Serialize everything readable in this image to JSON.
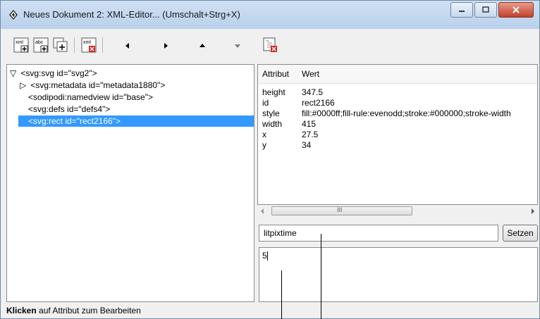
{
  "window": {
    "title": "Neues Dokument 2: XML-Editor... (Umschalt+Strg+X)"
  },
  "toolbar": {
    "buttons": [
      "new-element-node",
      "new-text-node",
      "duplicate-node",
      "delete-node"
    ],
    "nav": [
      "unindent",
      "indent",
      "raise",
      "lower"
    ]
  },
  "tree": {
    "nodes": [
      {
        "label": "<svg:svg id=\"svg2\">",
        "expander": "▽"
      },
      {
        "label": "<svg:metadata id=\"metadata1880\">",
        "expander": "▷"
      },
      {
        "label": "<sodipodi:namedview id=\"base\">",
        "expander": ""
      },
      {
        "label": "<svg:defs id=\"defs4\">",
        "expander": ""
      },
      {
        "label": "<svg:rect id=\"rect2166\">",
        "expander": "",
        "selected": true
      }
    ]
  },
  "attributes": {
    "col_attr": "Attribut",
    "col_value": "Wert",
    "rows": [
      {
        "key": "height",
        "value": "347.5"
      },
      {
        "key": "id",
        "value": "rect2166"
      },
      {
        "key": "style",
        "value": "fill:#0000ff;fill-rule:evenodd;stroke:#000000;stroke-width"
      },
      {
        "key": "width",
        "value": "415"
      },
      {
        "key": "x",
        "value": "27.5"
      },
      {
        "key": "y",
        "value": "34"
      }
    ],
    "scroll_grip": "III"
  },
  "editor": {
    "name_value": "litpixtime",
    "set_label": "Setzen",
    "value_text": "5"
  },
  "status": {
    "bold": "Klicken",
    "rest": " auf Attribut zum Bearbeiten"
  },
  "colors": {
    "selection": "#3399ff",
    "close_button": "#c2412b"
  }
}
